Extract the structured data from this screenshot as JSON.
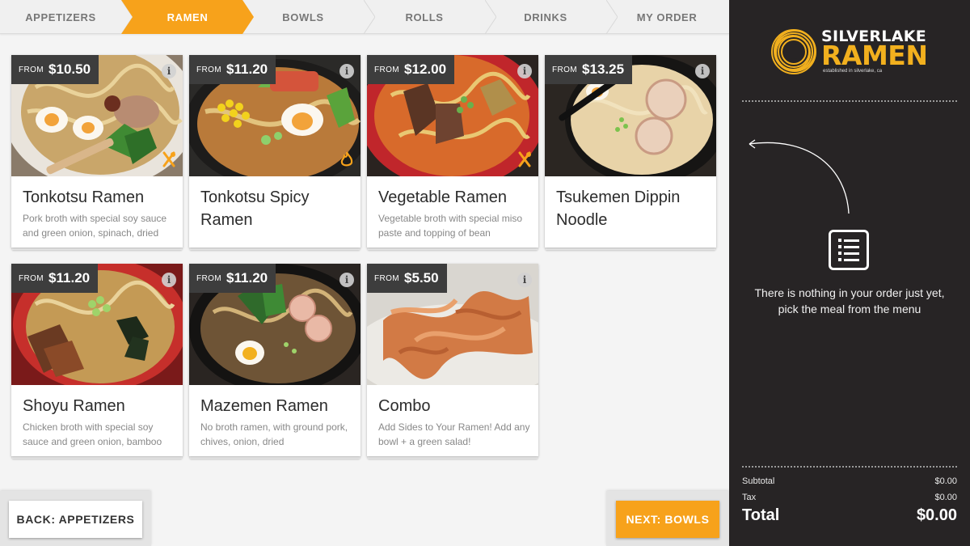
{
  "nav": {
    "tabs": [
      {
        "label": "APPETIZERS",
        "active": false
      },
      {
        "label": "RAMEN",
        "active": true
      },
      {
        "label": "BOWLS",
        "active": false
      },
      {
        "label": "ROLLS",
        "active": false
      },
      {
        "label": "DRINKS",
        "active": false
      },
      {
        "label": "MY ORDER",
        "active": false
      }
    ]
  },
  "menu": {
    "price_prefix": "FROM",
    "items": [
      {
        "price": "$10.50",
        "title": "Tonkotsu Ramen",
        "desc": "Pork broth with special soy sauce and green onion, spinach, dried",
        "badge": "utensils-icon"
      },
      {
        "price": "$11.20",
        "title": "Tonkotsu Spicy Ramen",
        "desc": "",
        "badge": "flame-icon"
      },
      {
        "price": "$12.00",
        "title": "Vegetable Ramen",
        "desc": "Vegetable broth with special miso paste and topping of bean",
        "badge": "utensils-icon"
      },
      {
        "price": "$13.25",
        "title": "Tsukemen Dippin Noodle",
        "desc": "",
        "badge": ""
      },
      {
        "price": "$11.20",
        "title": "Shoyu Ramen",
        "desc": "Chicken broth with special soy sauce and green onion, bamboo",
        "badge": ""
      },
      {
        "price": "$11.20",
        "title": "Mazemen Ramen",
        "desc": "No broth ramen, with ground pork, chives, onion, dried",
        "badge": ""
      },
      {
        "price": "$5.50",
        "title": "Combo",
        "desc": "Add Sides to Your Ramen! Add any bowl + a green salad!",
        "badge": ""
      }
    ]
  },
  "footer": {
    "back_label": "BACK: APPETIZERS",
    "next_label": "NEXT: BOWLS"
  },
  "order": {
    "logo_line1": "SILVERLAKE",
    "logo_line2": "RAMEN",
    "logo_tagline": "established in silverlake, ca",
    "empty_line1": "There is nothing in your order just yet,",
    "empty_line2": "pick the meal from the menu",
    "subtotal_label": "Subtotal",
    "subtotal_value": "$0.00",
    "tax_label": "Tax",
    "tax_value": "$0.00",
    "total_label": "Total",
    "total_value": "$0.00"
  },
  "colors": {
    "accent": "#f7a21b",
    "panel_bg": "#272425",
    "price_tag": "#3d3d3d"
  }
}
